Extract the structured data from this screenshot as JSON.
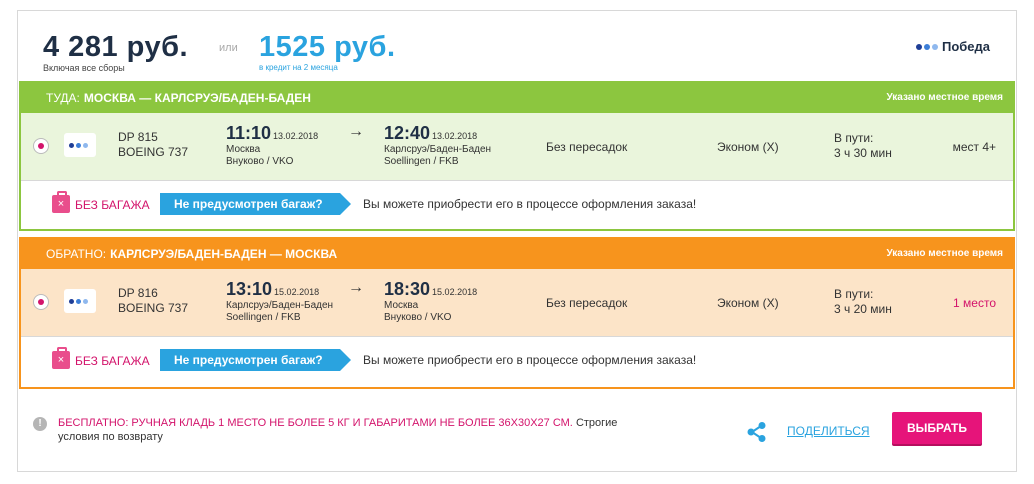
{
  "header": {
    "price": "4 281 руб.",
    "price_note": "Включая все сборы",
    "or_label": "или",
    "credit_price": "1525 руб.",
    "credit_note": "в кредит на 2 месяца",
    "airline": "Победа"
  },
  "colors": {
    "outbound": "#8cc63f",
    "return": "#f7941d",
    "accent_pink": "#e6147a",
    "accent_blue": "#2aa3df"
  },
  "outbound": {
    "direction_label": "ТУДА:",
    "route": "МОСКВА — КАРЛСРУЭ/БАДЕН-БАДЕН",
    "local_time_note": "Указано местное время",
    "flight_number": "DP 815",
    "aircraft": "BOEING 737",
    "dep_time": "11:10",
    "dep_date": "13.02.2018",
    "dep_city": "Москва",
    "dep_airport": "Внуково / VKO",
    "arr_time": "12:40",
    "arr_date": "13.02.2018",
    "arr_city": "Карлсруэ/Баден-Баден",
    "arr_airport": "Soellingen / FKB",
    "stops": "Без пересадок",
    "fare_class": "Эконом (X)",
    "duration_label": "В пути:",
    "duration": "3 ч 30 мин",
    "seats": "мест 4+",
    "baggage_label": "БЕЗ БАГАЖА",
    "baggage_tag": "Не предусмотрен багаж?",
    "baggage_note": "Вы можете приобрести его в процессе оформления заказа!"
  },
  "return": {
    "direction_label": "ОБРАТНО:",
    "route": "КАРЛСРУЭ/БАДЕН-БАДЕН — МОСКВА",
    "local_time_note": "Указано местное время",
    "flight_number": "DP 816",
    "aircraft": "BOEING 737",
    "dep_time": "13:10",
    "dep_date": "15.02.2018",
    "dep_city": "Карлсруэ/Баден-Баден",
    "dep_airport": "Soellingen / FKB",
    "arr_time": "18:30",
    "arr_date": "15.02.2018",
    "arr_city": "Москва",
    "arr_airport": "Внуково / VKO",
    "stops": "Без пересадок",
    "fare_class": "Эконом (X)",
    "duration_label": "В пути:",
    "duration": "3 ч 20 мин",
    "seats": "1 место",
    "baggage_label": "БЕЗ БАГАЖА",
    "baggage_tag": "Не предусмотрен багаж?",
    "baggage_note": "Вы можете приобрести его в процессе оформления заказа!"
  },
  "footer": {
    "free_label": "БЕСПЛАТНО: РУЧНАЯ КЛАДЬ 1 МЕСТО НЕ БОЛЕЕ 5 КГ И ГАБАРИТАМИ НЕ БОЛЕЕ 36X30X27 СМ.",
    "conditions": "Строгие условия по возврату",
    "share_label": "ПОДЕЛИТЬСЯ",
    "choose_label": "ВЫБРАТЬ"
  }
}
